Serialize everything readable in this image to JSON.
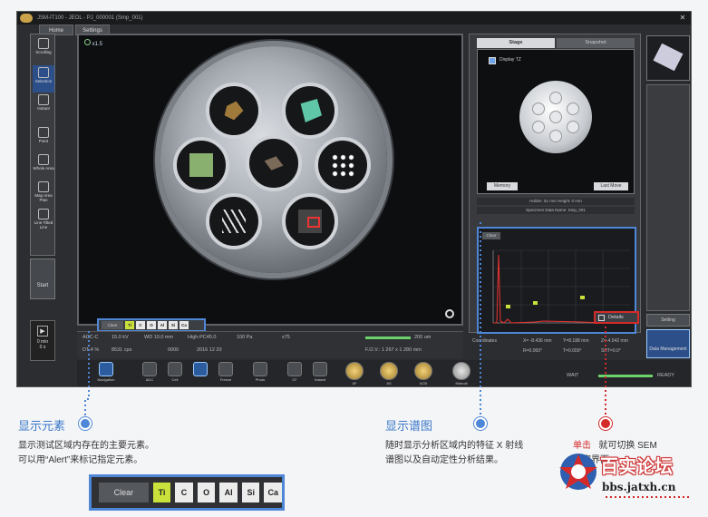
{
  "app": {
    "title": "JSM-IT100 - JEOL - PJ_000001 (Smp_001)",
    "tabs": [
      "Home",
      "Settings"
    ]
  },
  "toolbar_left": [
    {
      "label": "Scrolling"
    },
    {
      "label": "Selection"
    },
    {
      "label": "Instant"
    },
    {
      "label": "Point"
    },
    {
      "label": "Whole Area"
    },
    {
      "label": "Map Area Plan"
    },
    {
      "label": "Line Tilted Line"
    }
  ],
  "start": {
    "label": "Start"
  },
  "timer": {
    "value": "0 min",
    "sub": "0 s"
  },
  "viewer": {
    "zoom": "x1.5"
  },
  "alert_bar": {
    "clear": "Clear",
    "elements": [
      "Ti",
      "C",
      "O",
      "Al",
      "Si",
      "Ca"
    ],
    "active": "Ti"
  },
  "info": {
    "acc": "ACC-C",
    "kv": "15.0 kV",
    "wd": "WD 10.0 mm",
    "mode": "High-PC45.0",
    "pressure": "100 Pa",
    "mag": "x75",
    "dt": "DT 4 %",
    "cps": "8531 cps",
    "count": "0000",
    "date": "2016 12 20",
    "scale": "200 um",
    "fov": "F.O.V.: 1 267 x 1 280 mm"
  },
  "right_panel": {
    "tab_stage": "Stage",
    "tab_snapshot": "Snapshot",
    "display_tz": "Display TZ",
    "memory": "Memory",
    "last_move": "Last Move",
    "holder": "Holder: 51 mm  Height: 0 mm",
    "specimen": "Specimen Data Name: Smp_001",
    "spectrum_clear": "Clear",
    "details": "Details",
    "coordinates": "Coordinates",
    "x": "X= -8.436 mm",
    "y": "Y=8.188 mm",
    "z": "Z=-4.542 mm",
    "r": "R=0.000°",
    "t": "T=0.000°",
    "tilt": "SRT=0.0°"
  },
  "far_right": {
    "setting": "Setting",
    "data_mgmt": "Data Management"
  },
  "bottom_tools": [
    "Navigation",
    "ADC",
    "Cell",
    "",
    "Freeze",
    "Photo",
    "CF",
    "Instant",
    "AF",
    "AS",
    "ACB",
    "Manual"
  ],
  "status": {
    "wait": "WAIT",
    "ready": "READY"
  },
  "annotations": {
    "elements": {
      "title": "显示元素",
      "line1": "显示测试区域内存在的主要元素。",
      "line2": "可以用“Alert”来标记指定元素。"
    },
    "spectrum": {
      "title": "显示谱图",
      "line1": "随时显示分析区域内的特征 X 射线",
      "line2": "谱图以及自动定性分析结果。"
    },
    "details": {
      "lead": "单击",
      "line1_rest": "就可切换 SEM",
      "line2": "观察界面"
    }
  },
  "zoom_alert_bar": {
    "clear": "Clear",
    "elements": [
      "Ti",
      "C",
      "O",
      "Al",
      "Si",
      "Ca"
    ],
    "active": "Ti"
  },
  "watermark": {
    "title": "百实论坛",
    "url": "bbs.jatxh.cn"
  },
  "colors": {
    "accent_blue": "#4f87d8",
    "accent_red": "#d52a2a",
    "alert_green": "#c9e13a"
  }
}
